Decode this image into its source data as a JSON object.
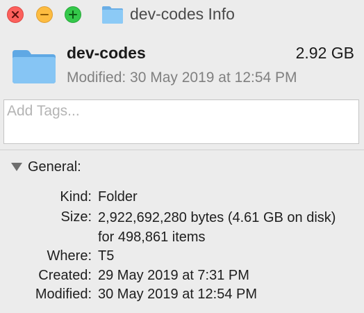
{
  "window": {
    "title": "dev-codes Info",
    "title_icon": "folder-icon",
    "controls": [
      "close-icon",
      "minimize-icon",
      "zoom-icon"
    ]
  },
  "header": {
    "name": "dev-codes",
    "size": "2.92 GB",
    "modified": "Modified: 30 May 2019 at 12:54 PM",
    "icon": "folder-icon"
  },
  "tags": {
    "placeholder": "Add Tags...",
    "value": ""
  },
  "general": {
    "title": "General:",
    "rows": [
      {
        "label": "Kind:",
        "value": "Folder"
      },
      {
        "label": "Size:",
        "value": "2,922,692,280 bytes (4.61 GB on disk) for 498,861 items"
      },
      {
        "label": "Where:",
        "value": "T5"
      },
      {
        "label": "Created:",
        "value": "29 May 2019 at 7:31 PM"
      },
      {
        "label": "Modified:",
        "value": "30 May 2019 at 12:54 PM"
      }
    ]
  },
  "colors": {
    "close": "#fc605c",
    "minimize": "#fdbc40",
    "zoom": "#34c84a",
    "folder": "#74b9ee"
  }
}
